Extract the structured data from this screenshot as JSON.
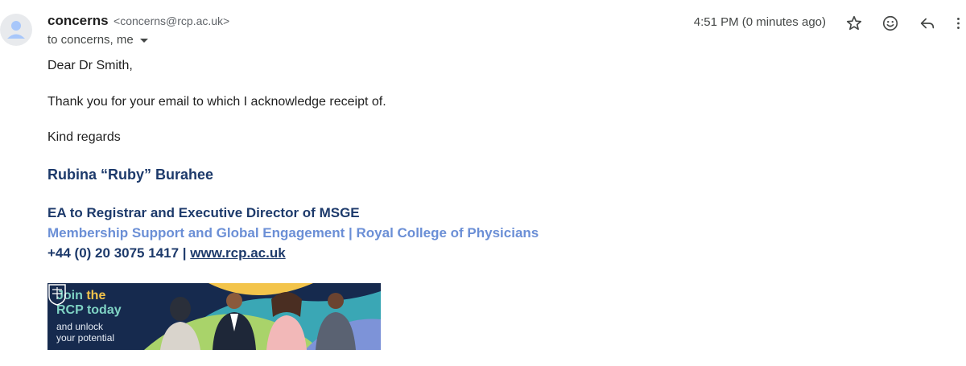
{
  "header": {
    "sender_name": "concerns",
    "sender_email": "<concerns@rcp.ac.uk>",
    "to_label": "to concerns, me",
    "timestamp": "4:51 PM (0 minutes ago)",
    "icons": [
      "avatar-icon",
      "star-icon",
      "emoji-icon",
      "reply-icon",
      "more-icon",
      "chevron-down-icon"
    ]
  },
  "body": {
    "greeting": "Dear Dr Smith,",
    "paragraph": "Thank you for your email to which I acknowledge receipt of.",
    "closing": "Kind regards"
  },
  "signature": {
    "name": "Rubina “Ruby” Burahee",
    "role": "EA to Registrar and Executive Director of MSGE",
    "department": "Membership Support and Global Engagement | Royal College of Physicians",
    "phone": "+44 (0) 20 3075 1417 |",
    "website": "www.rcp.ac.uk"
  },
  "banner": {
    "line1_prefix": "Join ",
    "line1_highlight": "the",
    "line2": "RCP today",
    "line3": "and unlock",
    "line4": "your potential"
  },
  "colors": {
    "signature_dark": "#1d3a6b",
    "signature_light": "#6b8fd6",
    "banner_bg": "#162a4e",
    "banner_accent": "#7fd3c4",
    "banner_highlight": "#f3c44b"
  }
}
